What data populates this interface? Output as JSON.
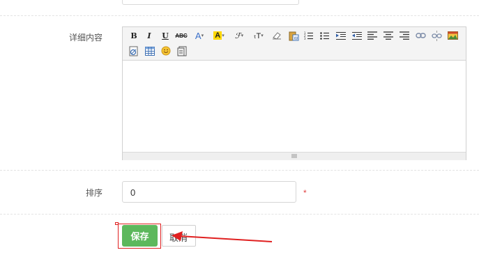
{
  "form": {
    "detail_label": "详细内容",
    "sort_label": "排序",
    "sort_value": "0",
    "required_mark": "*",
    "save_label": "保存",
    "cancel_label": "取消"
  },
  "editor": {
    "toolbar": [
      "bold-icon",
      "italic-icon",
      "underline-icon",
      "strikethrough-icon",
      "font-color-icon",
      "background-color-icon",
      "font-family-icon",
      "font-size-icon",
      "clear-format-icon",
      "paste-word-icon",
      "ordered-list-icon",
      "unordered-list-icon",
      "indent-icon",
      "outdent-icon",
      "align-left-icon",
      "align-center-icon",
      "align-right-icon",
      "link-icon",
      "unlink-icon",
      "image-icon",
      "flash-icon",
      "table-icon",
      "emoticon-icon",
      "template-icon"
    ]
  },
  "colors": {
    "save_button": "#5cb85c",
    "annotation_red": "#e02020",
    "required": "#e04040"
  }
}
